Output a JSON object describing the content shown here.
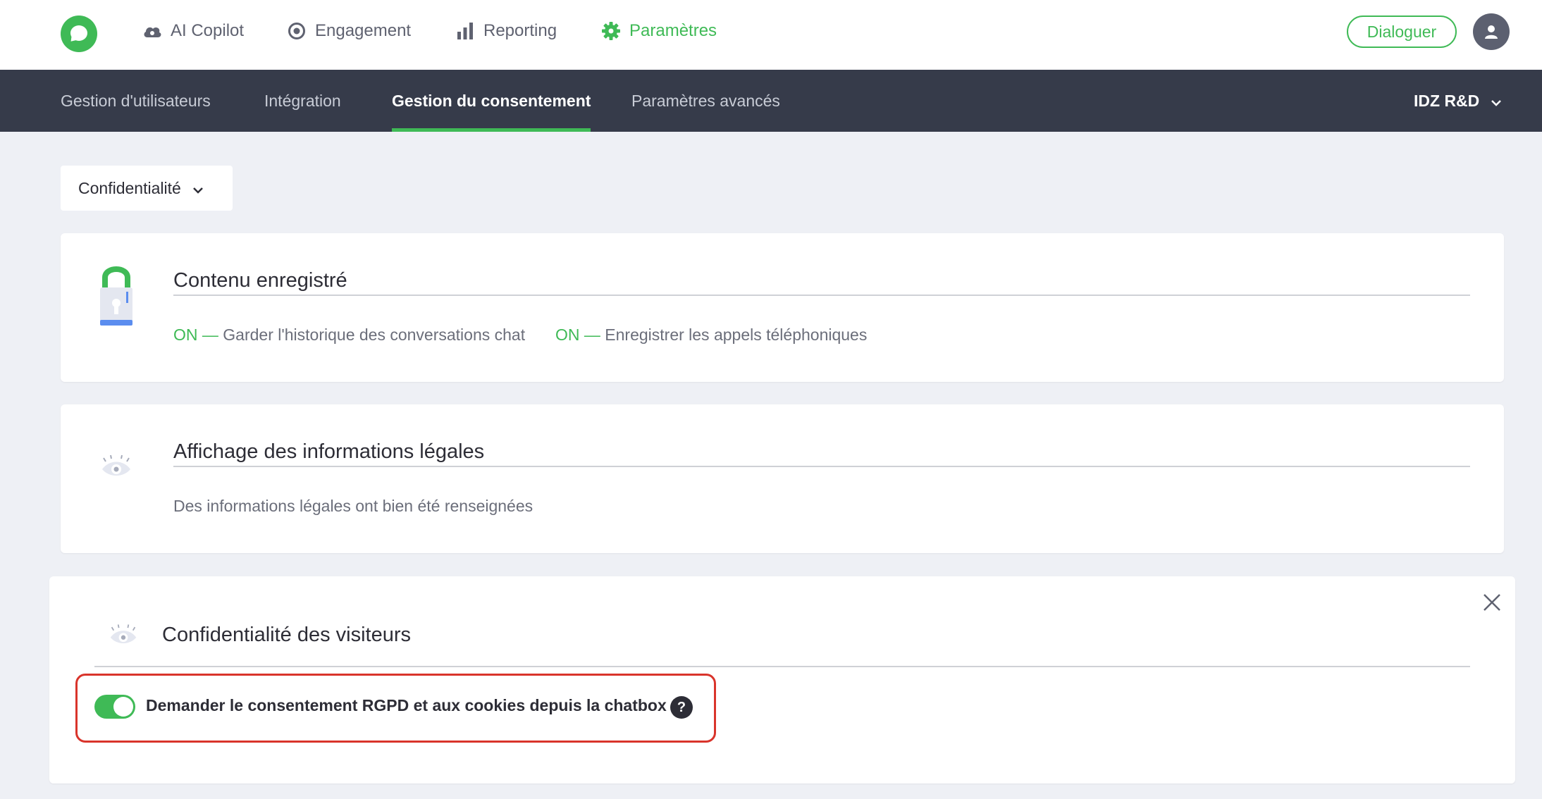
{
  "topnav": {
    "items": [
      {
        "label": "AI Copilot",
        "icon": "cloud-icon"
      },
      {
        "label": "Engagement",
        "icon": "target-icon"
      },
      {
        "label": "Reporting",
        "icon": "bar-chart-icon"
      },
      {
        "label": "Paramètres",
        "icon": "gear-icon",
        "active": true
      }
    ],
    "cta_label": "Dialoguer",
    "accent_color": "#3fba56"
  },
  "subnav": {
    "tabs": [
      {
        "label": "Gestion d'utilisateurs"
      },
      {
        "label": "Intégration"
      },
      {
        "label": "Gestion du consentement",
        "active": true
      },
      {
        "label": "Paramètres avancés"
      }
    ],
    "account_label": "IDZ R&D",
    "background_color": "#363b4a"
  },
  "filter": {
    "selected": "Confidentialité"
  },
  "cards": {
    "recorded": {
      "title": "Contenu enregistré",
      "icon": "padlock-icon",
      "items": [
        {
          "state": "ON —",
          "label": "Garder l'historique des conversations chat"
        },
        {
          "state": "ON —",
          "label": "Enregistrer les appels téléphoniques"
        }
      ]
    },
    "legal": {
      "title": "Affichage des informations légales",
      "icon": "eye-icon",
      "text": "Des informations légales ont bien été renseignées"
    },
    "privacy": {
      "title": "Confidentialité des visiteurs",
      "icon": "eye-icon",
      "toggle": {
        "on": true,
        "label": "Demander le consentement RGPD et aux cookies depuis la chatbox"
      },
      "help_label": "?",
      "highlight_color": "#d9342b"
    }
  }
}
